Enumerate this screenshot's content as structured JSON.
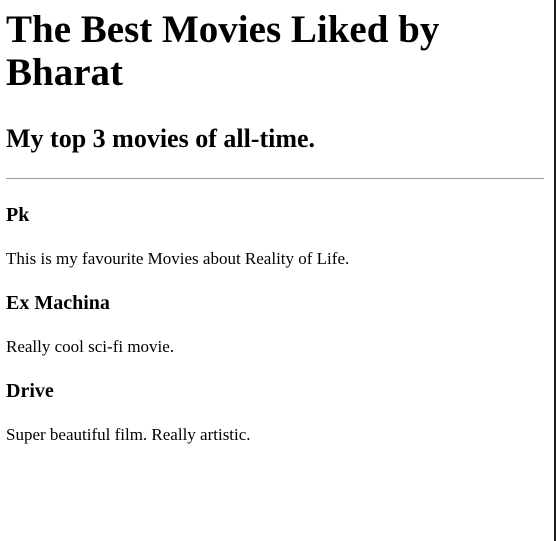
{
  "page": {
    "title": "The Best Movies Liked by Bharat",
    "subtitle": "My top 3 movies of all-time."
  },
  "movies": [
    {
      "title": "Pk",
      "description": "This is my favourite Movies about Reality of Life."
    },
    {
      "title": "Ex Machina",
      "description": "Really cool sci-fi movie."
    },
    {
      "title": "Drive",
      "description": "Super beautiful film. Really artistic."
    }
  ]
}
